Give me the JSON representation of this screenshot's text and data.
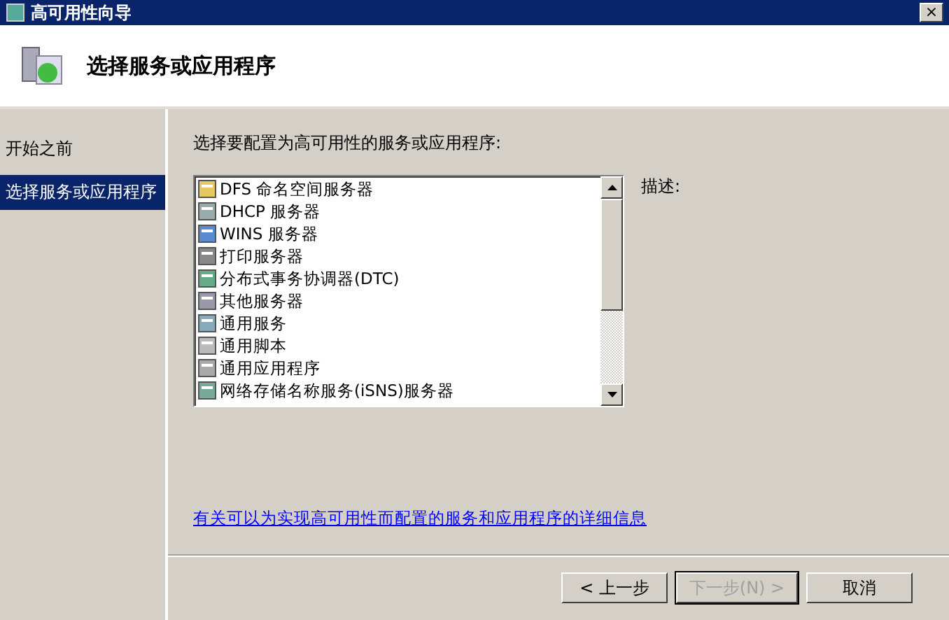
{
  "window": {
    "title": "高可用性向导",
    "close": "×"
  },
  "header": {
    "title": "选择服务或应用程序"
  },
  "sidebar": {
    "items": [
      {
        "label": "开始之前",
        "selected": false
      },
      {
        "label": "选择服务或应用程序",
        "selected": true
      }
    ]
  },
  "main": {
    "prompt": "选择要配置为高可用性的服务或应用程序:",
    "list": [
      {
        "label": "DFS 命名空间服务器",
        "selected": false
      },
      {
        "label": "DHCP 服务器",
        "selected": false
      },
      {
        "label": "WINS 服务器",
        "selected": false
      },
      {
        "label": "打印服务器",
        "selected": false
      },
      {
        "label": "分布式事务协调器(DTC)",
        "selected": false
      },
      {
        "label": "其他服务器",
        "selected": false
      },
      {
        "label": "通用服务",
        "selected": false
      },
      {
        "label": "通用脚本",
        "selected": false
      },
      {
        "label": "通用应用程序",
        "selected": false
      },
      {
        "label": "网络存储名称服务(iSNS)服务器",
        "selected": false
      }
    ],
    "description_label": "描述:",
    "link": "有关可以为实现高可用性而配置的服务和应用程序的详细信息"
  },
  "buttons": [
    {
      "label": "< 上一步",
      "disabled": false,
      "default": false
    },
    {
      "label": "下一步(N) >",
      "disabled": true,
      "default": true
    },
    {
      "label": "取消",
      "disabled": false,
      "default": false
    }
  ]
}
